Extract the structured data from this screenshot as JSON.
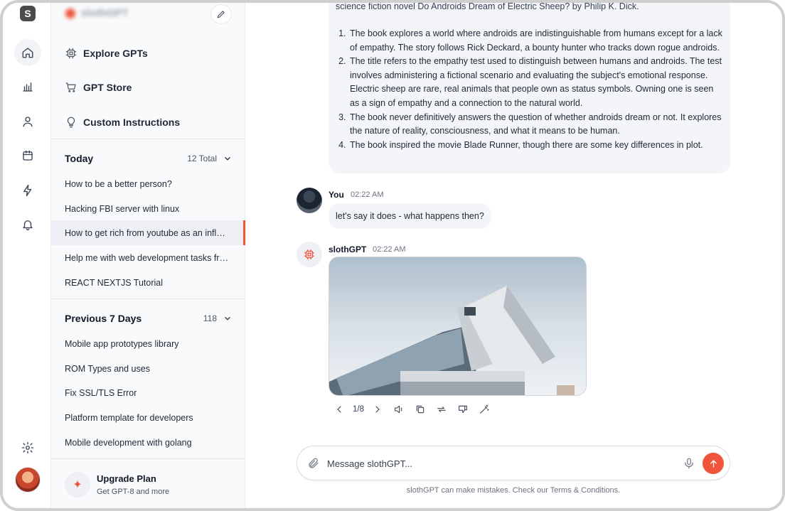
{
  "app": {
    "logo_letter": "S",
    "brand": "slothGPT"
  },
  "nav": [
    {
      "label": "Explore GPTs",
      "icon": "chip-icon"
    },
    {
      "label": "GPT Store",
      "icon": "cart-icon"
    },
    {
      "label": "Custom Instructions",
      "icon": "lightbulb-icon"
    }
  ],
  "today": {
    "title": "Today",
    "count": "12 Total",
    "items": [
      "How to be a better person?",
      "Hacking FBI server with linux",
      "How to get rich from youtube as an influencer",
      "Help me with web development tasks from scratch",
      "REACT NEXTJS Tutorial"
    ]
  },
  "previous": {
    "title": "Previous 7 Days",
    "count": "118",
    "items": [
      "Mobile app prototypes library",
      "ROM Types and uses",
      "Fix SSL/TLS Error",
      "Platform template for developers",
      "Mobile development with golang"
    ]
  },
  "upgrade": {
    "title": "Upgrade Plan",
    "subtitle": "Get GPT-8 and more"
  },
  "conversation": {
    "bot_intro": "science fiction novel Do Androids Dream of Electric Sheep? by Philip K. Dick.",
    "bot_points": [
      "The book explores a world where androids are indistinguishable from humans except for a lack of empathy. The story follows Rick Deckard, a bounty hunter who tracks down rogue androids.",
      "The title refers to the  empathy test used to distinguish between humans and androids. The test involves administering a fictional scenario and evaluating the subject's emotional response. Electric sheep are rare, real animals that people own as status symbols. Owning one is seen as a sign of empathy and a connection to the natural world.",
      "The book never definitively answers the question of whether androids dream or not. It explores the nature of reality, consciousness, and what it means to be human.",
      "The book inspired the movie Blade Runner, though there are some key differences in plot."
    ],
    "user_name": "You",
    "user_time": "02:22 AM",
    "user_message": "let's say it does - what happens then?",
    "bot_name": "slothGPT",
    "bot_time": "02:22 AM",
    "pager": "1/8"
  },
  "composer": {
    "placeholder": "Message slothGPT..."
  },
  "disclaimer": "slothGPT can make mistakes. Check our Terms & Conditions.",
  "colors": {
    "accent": "#f0553b",
    "sidebar_bg": "#f9fafb",
    "bubble_bg": "#f3f5f8"
  }
}
